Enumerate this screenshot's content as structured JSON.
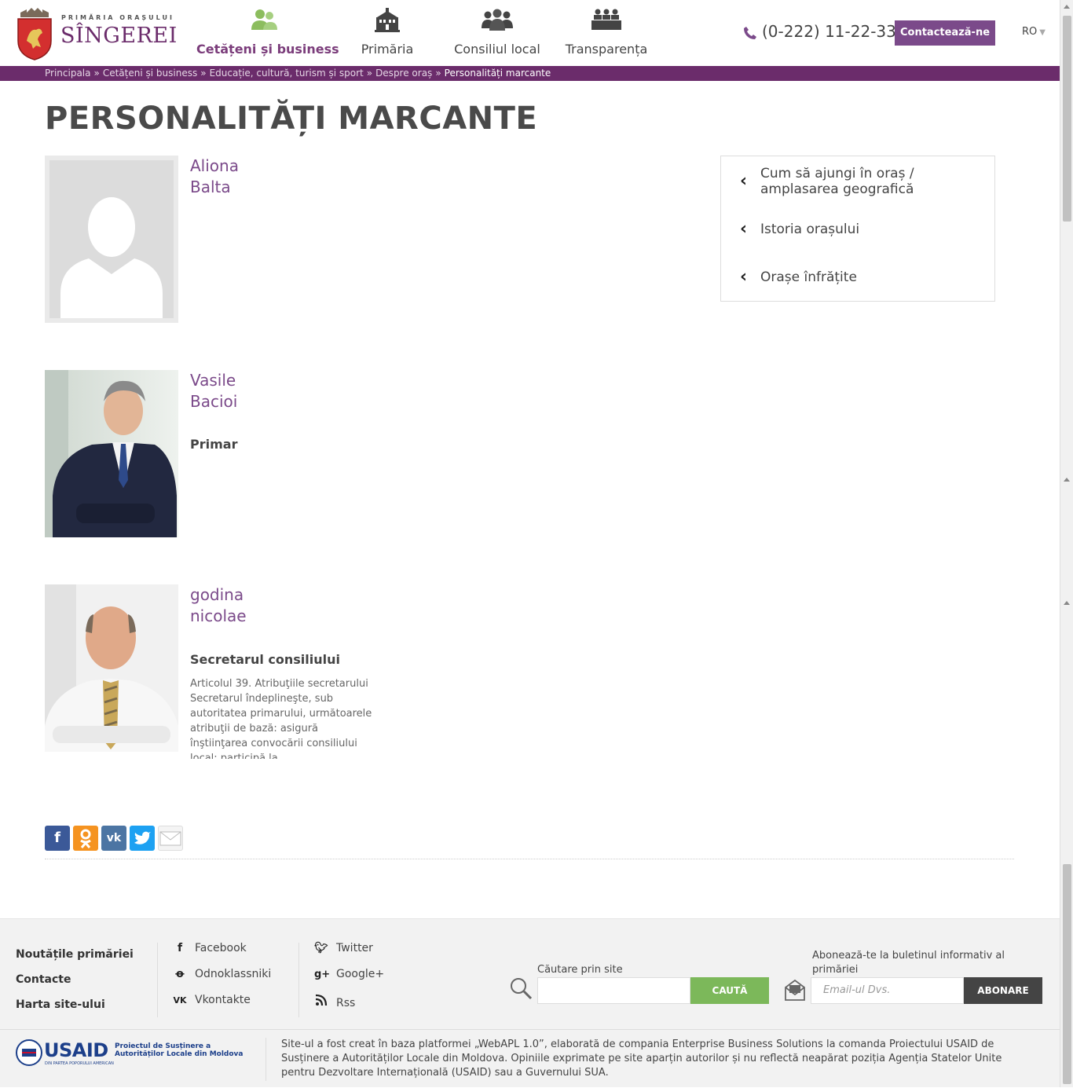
{
  "header": {
    "logo_top": "PRIMĂRIA ORAȘULUI",
    "logo_main": "SÎNGEREI",
    "nav": [
      {
        "label": "Cetățeni și business",
        "icon": "citizens-icon",
        "active": true
      },
      {
        "label": "Primăria",
        "icon": "town-hall-icon",
        "active": false
      },
      {
        "label": "Consiliul local",
        "icon": "council-icon",
        "active": false
      },
      {
        "label": "Transparența",
        "icon": "transparency-icon",
        "active": false
      }
    ],
    "phone": "(0-222) 11-22-33",
    "contact_button": "Contactează-ne",
    "language": "RO",
    "accent_color": "#6b2c6b",
    "nav_active_icon_color": "#8cbd5e"
  },
  "breadcrumb": {
    "items": [
      "Principala",
      "Cetățeni și business",
      "Educație, cultură, turism și sport",
      "Despre oraș"
    ],
    "current": "Personalități marcante",
    "separator": "»"
  },
  "page_title": "PERSONALITĂȚI MARCANTE",
  "persons": [
    {
      "first": "Aliona",
      "last": "Balta",
      "role": "",
      "description": ""
    },
    {
      "first": "Vasile",
      "last": "Bacioi",
      "role": "Primar",
      "description": ""
    },
    {
      "first": "godina",
      "last": "nicolae",
      "role": "Secretarul consiliului",
      "description": "Articolul 39. Atribuţiile secretarului Secretarul îndeplineşte, sub autoritatea primarului, următoarele atribuţii de bază: asigură înştiinţarea convocării consiliului local; participă la"
    }
  ],
  "sidebar": {
    "links": [
      "Cum să ajungi în oraș / amplasarea geografică",
      "Istoria orașului",
      "Orașe înfrățite"
    ]
  },
  "share": [
    "facebook-icon",
    "odnoklassniki-icon",
    "vkontakte-icon",
    "twitter-icon",
    "email-icon"
  ],
  "footer": {
    "links": [
      "Noutățile primăriei",
      "Contacte",
      "Harta site-ului"
    ],
    "social_col1": [
      {
        "icon": "facebook-icon",
        "label": "Facebook"
      },
      {
        "icon": "odnoklassniki-icon",
        "label": "Odnoklassniki"
      },
      {
        "icon": "vkontakte-icon",
        "label": "Vkontakte"
      }
    ],
    "social_col2": [
      {
        "icon": "twitter-icon",
        "label": "Twitter"
      },
      {
        "icon": "googleplus-icon",
        "label": "Google+"
      },
      {
        "icon": "rss-icon",
        "label": "Rss"
      }
    ],
    "search_label": "Căutare prin site",
    "search_button": "CAUTĂ",
    "subscribe_label": "Abonează-te la buletinul informativ al primăriei",
    "subscribe_placeholder": "Email-ul Dvs.",
    "subscribe_button": "ABONARE",
    "usaid_brand": "USAID",
    "usaid_sub": "DIN PARTEA POPORULUI AMERICAN",
    "usaid_project": "Proiectul de Susținere a Autorităților Locale din Moldova",
    "note": "Site-ul a fost creat în baza platformei „WebAPL 1.0”, elaborată de compania Enterprise Business Solutions la comanda Proiectului USAID de Susținere a Autorităților Locale din Moldova. Opiniile exprimate pe site aparțin autorilor și nu reflectă neapărat poziția Agenția Statelor Unite pentru Dezvoltare Internațională (USAID) sau a Guvernului SUA."
  }
}
